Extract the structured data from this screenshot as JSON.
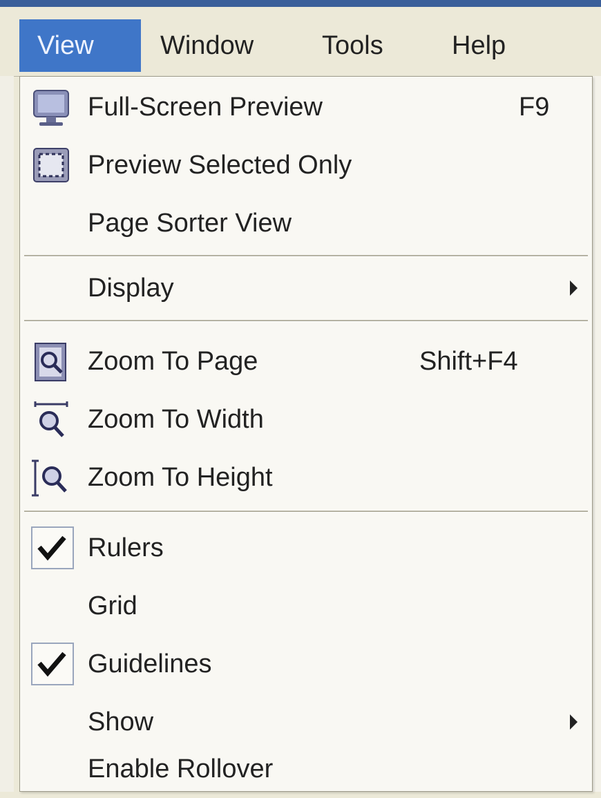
{
  "menubar": {
    "items": [
      {
        "label": "View",
        "active": true
      },
      {
        "label": "Window",
        "active": false
      },
      {
        "label": "Tools",
        "active": false
      },
      {
        "label": "Help",
        "active": false
      }
    ]
  },
  "menu": {
    "items": [
      {
        "label": "Full-Screen Preview",
        "shortcut": "F9",
        "icon": "monitor-icon"
      },
      {
        "label": "Preview Selected Only",
        "icon": "preview-selected-icon"
      },
      {
        "label": "Page Sorter View"
      },
      {
        "label": "Display",
        "submenu": true
      },
      {
        "label": "Zoom To Page",
        "shortcut": "Shift+F4",
        "icon": "zoom-page-icon"
      },
      {
        "label": "Zoom To Width",
        "icon": "zoom-width-icon"
      },
      {
        "label": "Zoom To Height",
        "icon": "zoom-height-icon"
      },
      {
        "label": "Rulers",
        "checked": true
      },
      {
        "label": "Grid",
        "checked": false
      },
      {
        "label": "Guidelines",
        "checked": true
      },
      {
        "label": "Show",
        "submenu": true
      },
      {
        "label": "Enable Rollover"
      }
    ]
  },
  "colors": {
    "highlight": "#3f76c8",
    "menu_bg": "#f9f8f3",
    "bar_bg": "#ece9d8"
  }
}
